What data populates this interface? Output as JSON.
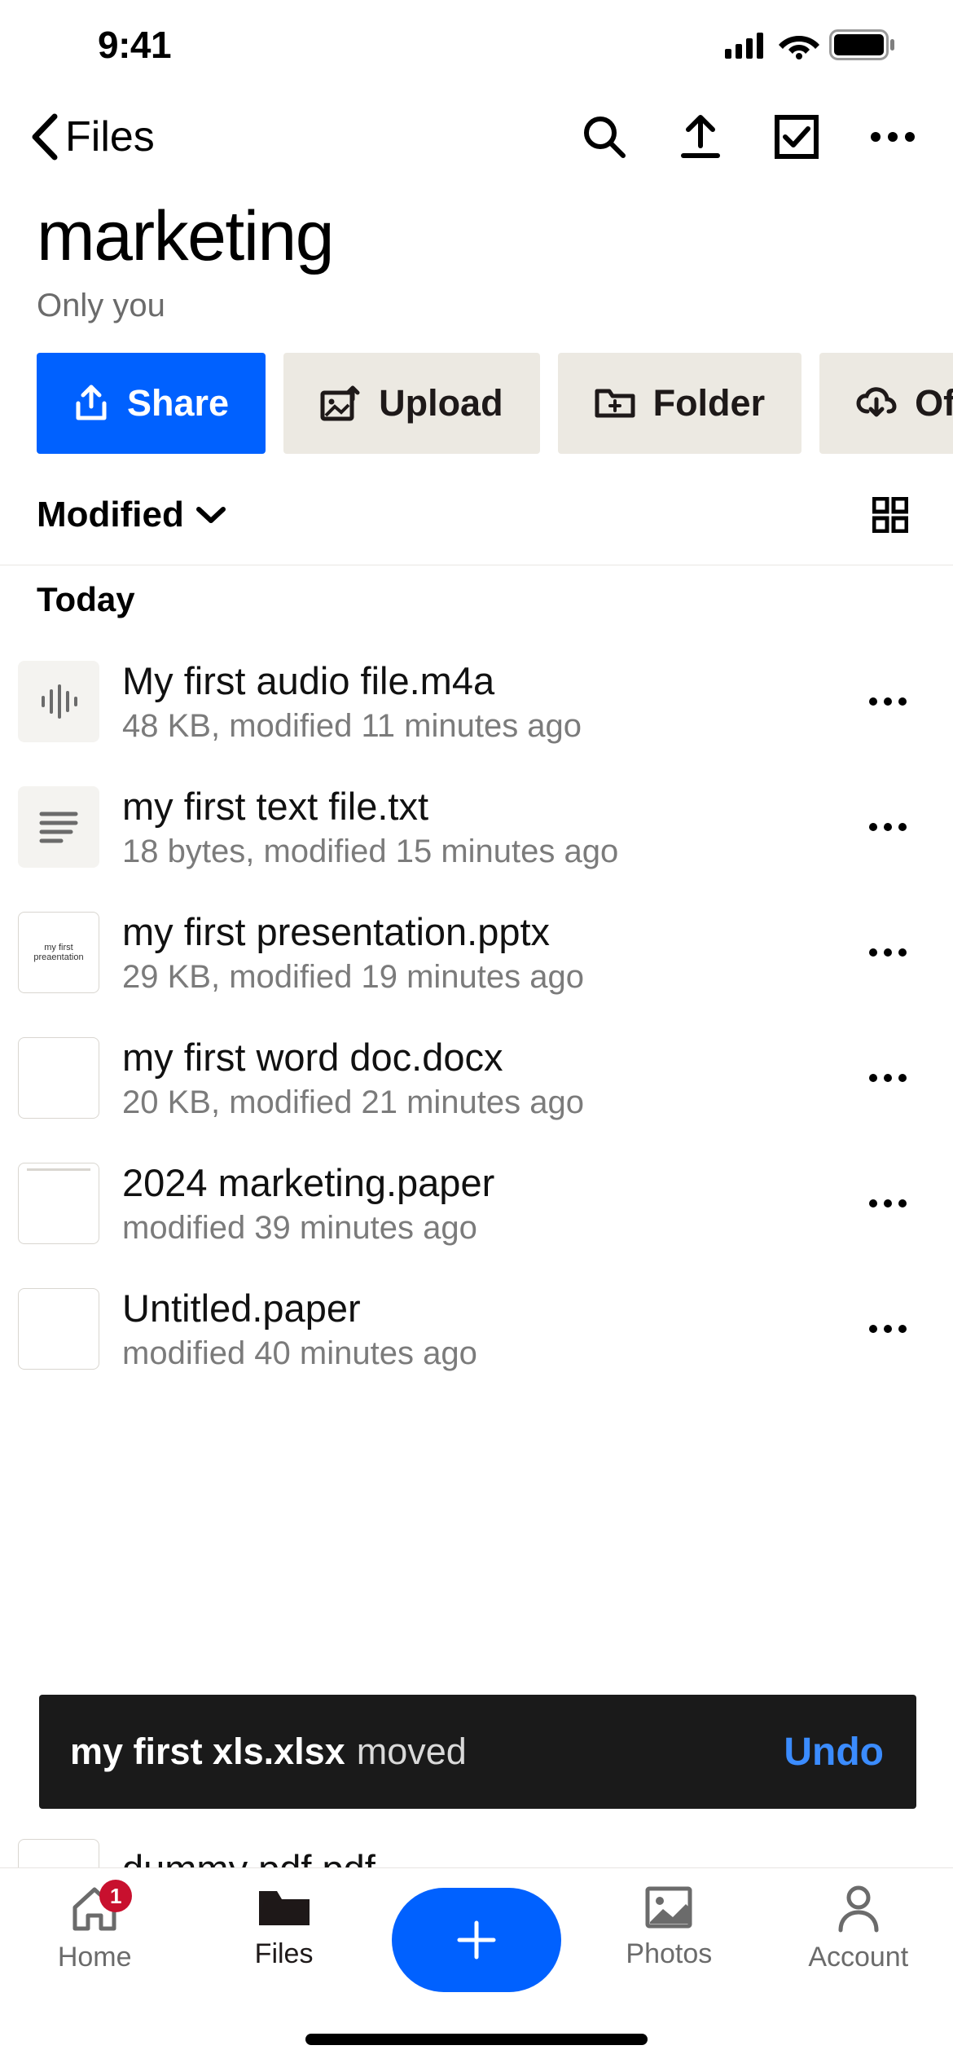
{
  "status": {
    "time": "9:41"
  },
  "nav": {
    "back_label": "Files"
  },
  "header": {
    "title": "marketing",
    "subtitle": "Only you"
  },
  "actions": {
    "share": "Share",
    "upload": "Upload",
    "folder": "Folder",
    "offline": "Offline"
  },
  "sort": {
    "label": "Modified"
  },
  "section": {
    "today": "Today"
  },
  "files": [
    {
      "name": "My first audio file.m4a",
      "meta": "48 KB, modified 11 minutes ago",
      "icon": "audio"
    },
    {
      "name": "my first text file.txt",
      "meta": "18 bytes, modified 15 minutes ago",
      "icon": "text"
    },
    {
      "name": "my first presentation.pptx",
      "meta": "29 KB, modified 19 minutes ago",
      "icon": "pptx",
      "thumb_text": "my first preaentation"
    },
    {
      "name": "my first word doc.docx",
      "meta": "20 KB, modified 21 minutes ago",
      "icon": "blank"
    },
    {
      "name": "2024 marketing.paper",
      "meta": "modified 39 minutes ago",
      "icon": "paper"
    },
    {
      "name": "Untitled.paper",
      "meta": "modified 40 minutes ago",
      "icon": "paper"
    }
  ],
  "partial_file": {
    "name": "dummy pdf.pdf"
  },
  "toast": {
    "file": "my first xls.xlsx",
    "status": "moved",
    "action": "Undo"
  },
  "tabs": {
    "home": "Home",
    "home_badge": "1",
    "files": "Files",
    "photos": "Photos",
    "account": "Account"
  }
}
